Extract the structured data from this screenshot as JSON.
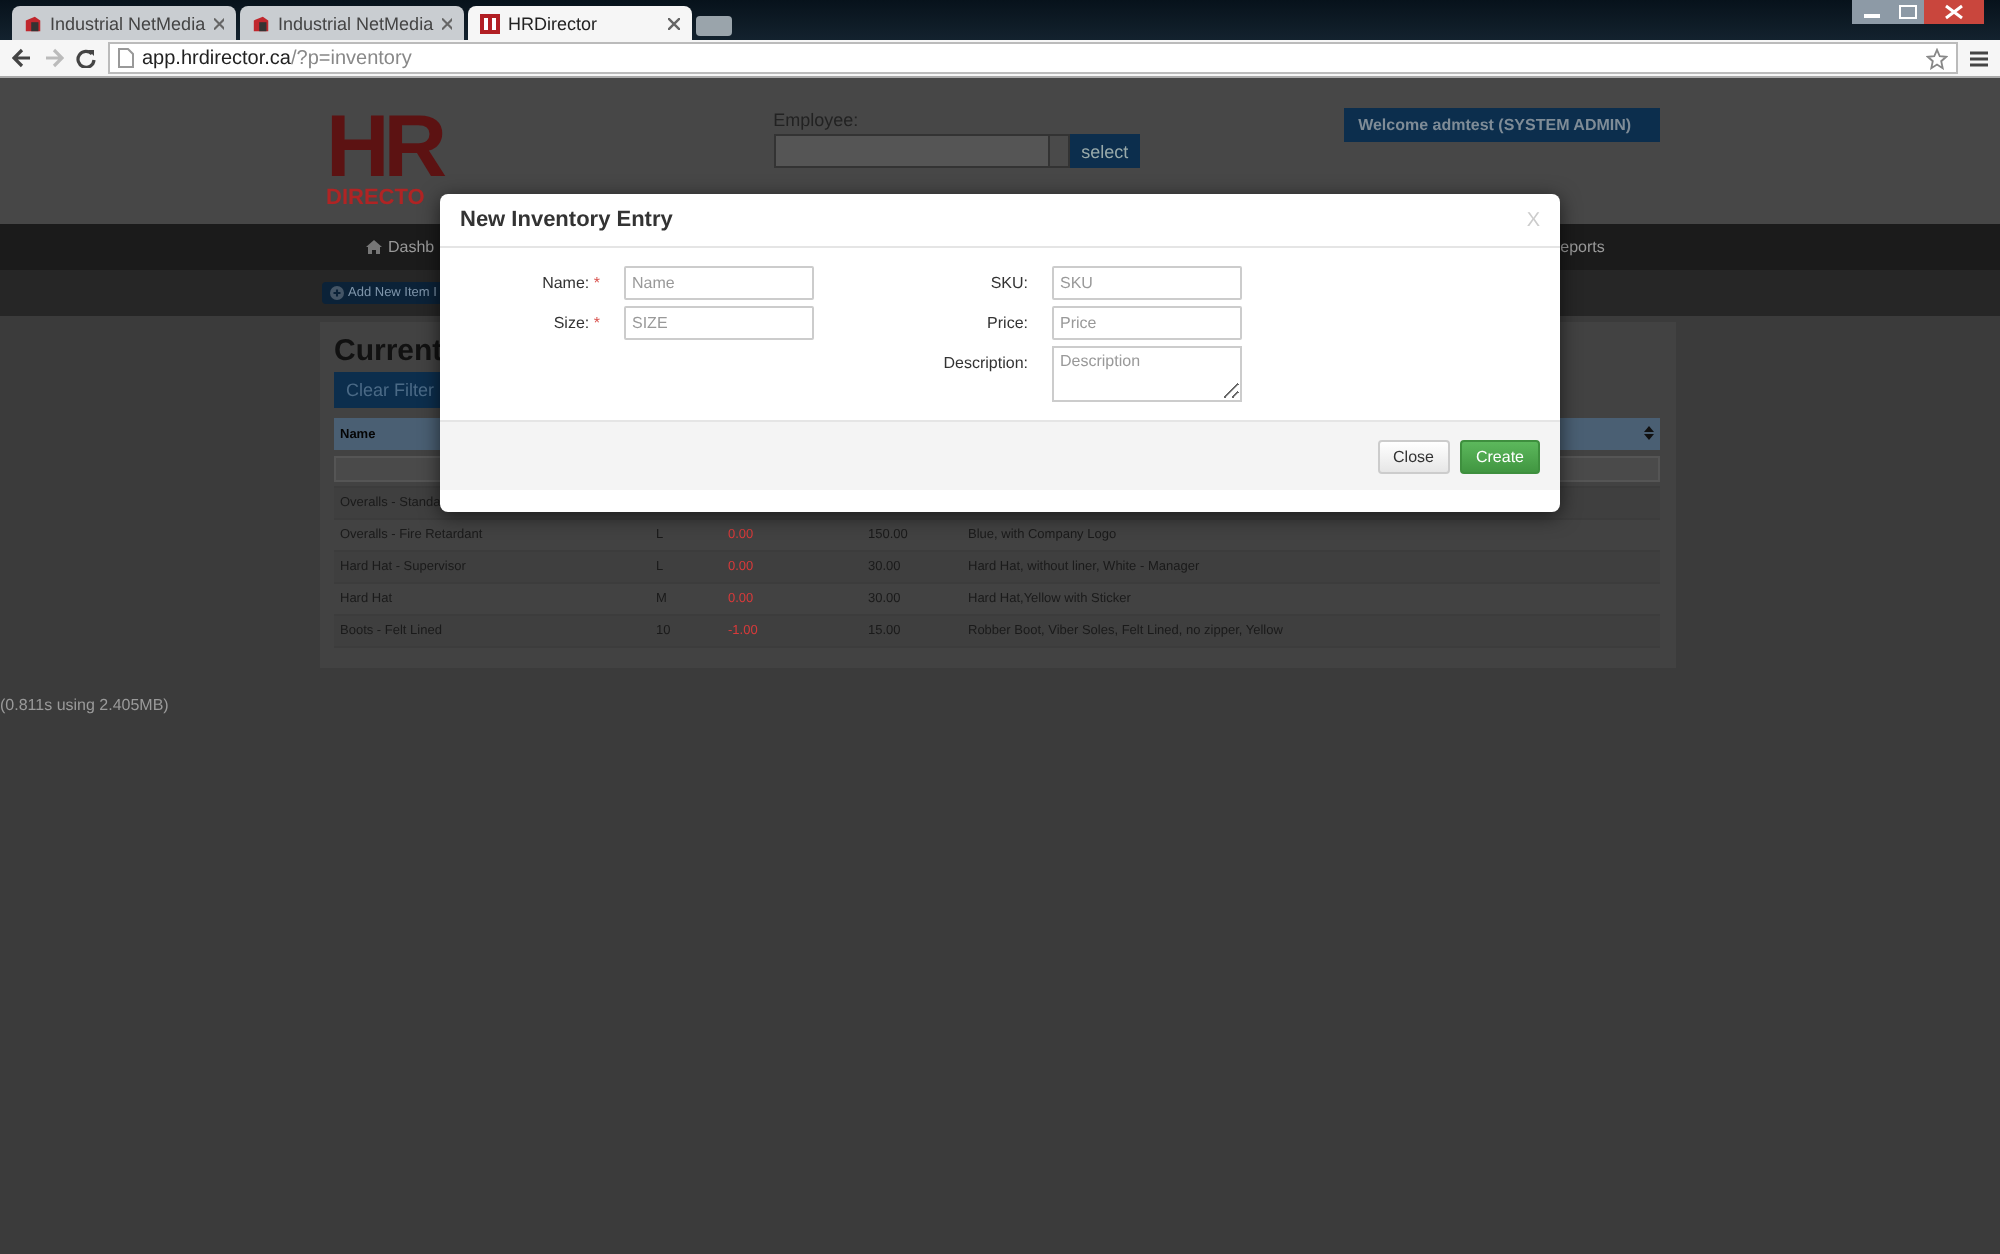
{
  "browser": {
    "tabs": [
      {
        "title": "Industrial NetMedia",
        "selected": false
      },
      {
        "title": "Industrial NetMedia",
        "selected": false
      },
      {
        "title": "HRDirector",
        "selected": true
      }
    ],
    "url_host": "app.hrdirector.ca",
    "url_path": "/?p=inventory"
  },
  "header": {
    "logo_top": "HR",
    "logo_bottom": "DIRECTO",
    "employee_label": "Employee:",
    "select_button": "select",
    "welcome": "Welcome admtest (SYSTEM ADMIN)"
  },
  "nav": {
    "items": [
      "Dashb",
      "eports"
    ]
  },
  "add_item": "Add New Item I",
  "page_title": "Current",
  "clear_filter": "Clear Filter",
  "table": {
    "columns": [
      "Name"
    ],
    "rows": [
      [
        "Overalls - Standa"
      ],
      [
        "Overalls - Fire Retardant",
        "L",
        "0.00",
        "150.00",
        "Blue, with Company Logo"
      ],
      [
        "Hard Hat - Supervisor",
        "L",
        "0.00",
        "30.00",
        "Hard Hat, without liner, White - Manager"
      ],
      [
        "Hard Hat",
        "M",
        "0.00",
        "30.00",
        "Hard Hat,Yellow with Sticker"
      ],
      [
        "Boots - Felt Lined",
        "10",
        "-1.00",
        "15.00",
        "Robber Boot, Viber Soles, Felt Lined, no zipper, Yellow"
      ]
    ]
  },
  "footer_note": "(0.811s using 2.405MB)",
  "modal": {
    "title": "New Inventory Entry",
    "close_glyph": "X",
    "fields_left": [
      {
        "label": "Name:",
        "required_mark": "*",
        "placeholder": "Name",
        "kind": "input"
      },
      {
        "label": "Size:",
        "required_mark": "*",
        "placeholder": "SIZE",
        "kind": "input"
      }
    ],
    "fields_right": [
      {
        "label": "SKU:",
        "placeholder": "SKU",
        "kind": "input"
      },
      {
        "label": "Price:",
        "placeholder": "Price",
        "kind": "input"
      },
      {
        "label": "Description:",
        "placeholder": "Description",
        "kind": "textarea"
      }
    ],
    "buttons": [
      {
        "label": "Close",
        "kind": "default"
      },
      {
        "label": "Create",
        "kind": "primary"
      }
    ]
  }
}
